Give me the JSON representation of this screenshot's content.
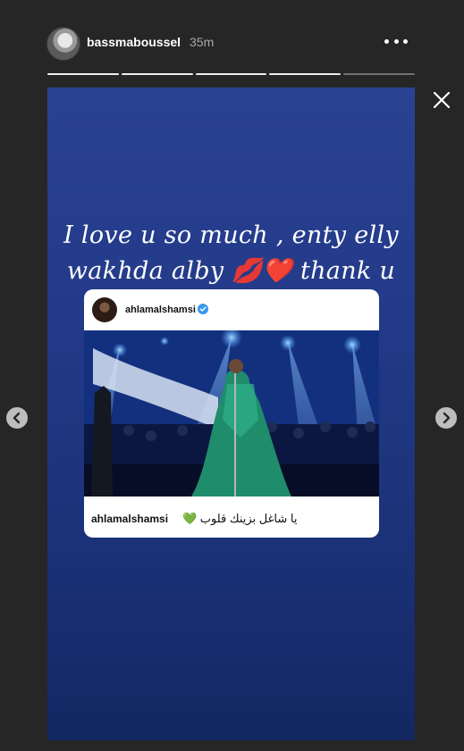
{
  "header": {
    "username": "bassmaboussel",
    "time": "35m"
  },
  "progress": {
    "segments": 5,
    "current": 4
  },
  "story": {
    "caption_line1": "I love u so much , enty elly",
    "caption_line2": "wakhda alby 💋❤️ thank u",
    "background_color": "#223a88"
  },
  "shared_post": {
    "username": "ahlamalshamsi",
    "verified": true,
    "caption_text": "يا شاغل بزينك قلوب 💚"
  },
  "icons": {
    "more": "more-dots-icon",
    "close": "close-icon",
    "prev": "chevron-left-icon",
    "next": "chevron-right-icon",
    "verified": "verified-badge-icon"
  }
}
